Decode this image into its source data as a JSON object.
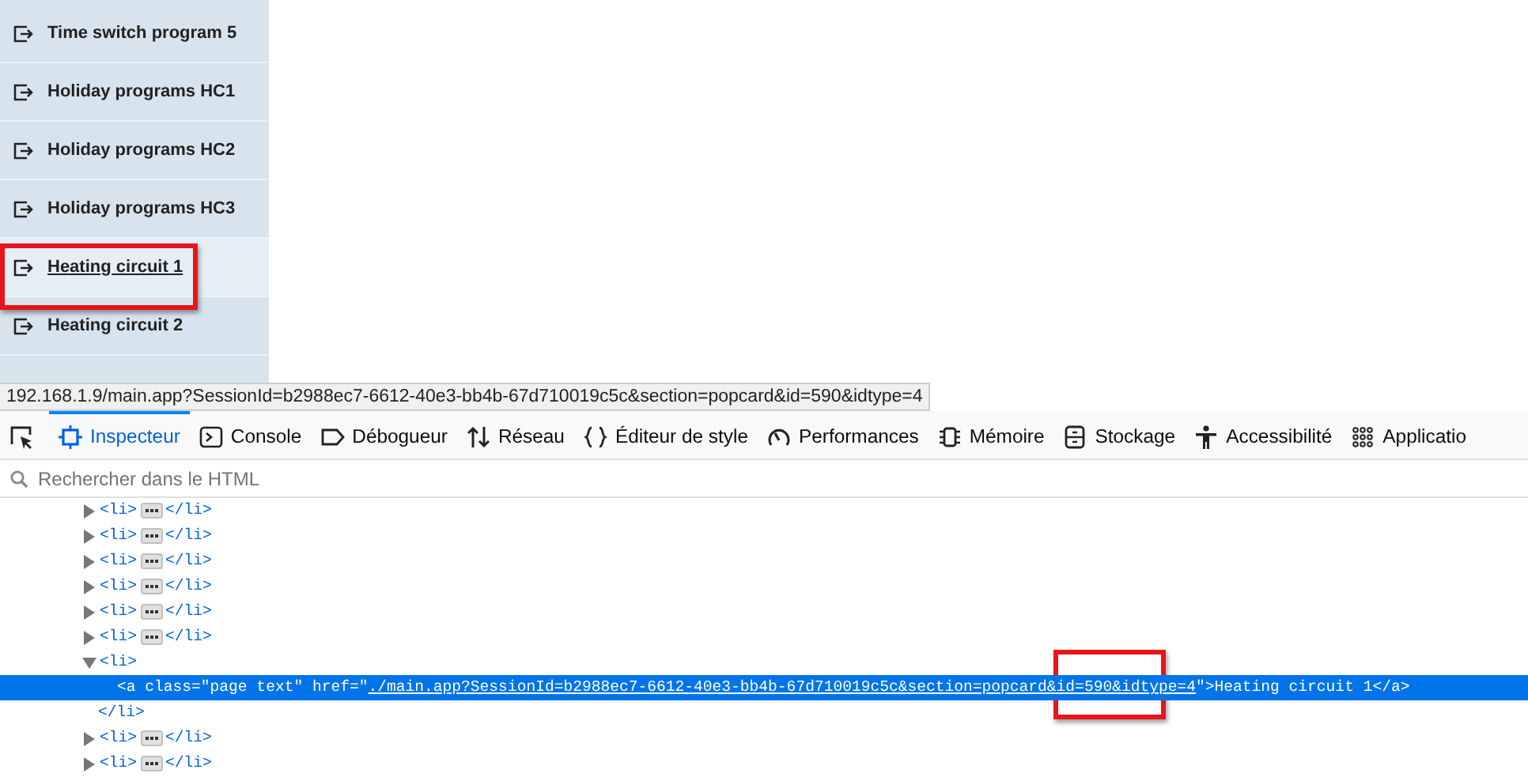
{
  "sidebar": {
    "items": [
      {
        "label": "Time switch program 5",
        "selected": false,
        "highlighted": false
      },
      {
        "label": "Holiday programs HC1",
        "selected": false,
        "highlighted": false
      },
      {
        "label": "Holiday programs HC2",
        "selected": false,
        "highlighted": false
      },
      {
        "label": "Holiday programs HC3",
        "selected": false,
        "highlighted": false
      },
      {
        "label": "Heating circuit 1",
        "selected": true,
        "highlighted": true
      },
      {
        "label": "Heating circuit 2",
        "selected": false,
        "highlighted": false
      }
    ]
  },
  "status_bar": {
    "url": "192.168.1.9/main.app?SessionId=b2988ec7-6612-40e3-bb4b-67d710019c5c&section=popcard&id=590&idtype=4"
  },
  "devtools": {
    "tabs": [
      {
        "kind": "picker",
        "selected": false
      },
      {
        "kind": "inspector",
        "label": "Inspecteur",
        "selected": true
      },
      {
        "kind": "console",
        "label": "Console",
        "selected": false
      },
      {
        "kind": "debugger",
        "label": "Débogueur",
        "selected": false
      },
      {
        "kind": "network",
        "label": "Réseau",
        "selected": false
      },
      {
        "kind": "style",
        "label": "Éditeur de style",
        "selected": false
      },
      {
        "kind": "performance",
        "label": "Performances",
        "selected": false
      },
      {
        "kind": "memory",
        "label": "Mémoire",
        "selected": false
      },
      {
        "kind": "storage",
        "label": "Stockage",
        "selected": false
      },
      {
        "kind": "accessibility",
        "label": "Accessibilité",
        "selected": false
      },
      {
        "kind": "application",
        "label": "Applicatio",
        "selected": false
      }
    ],
    "search": {
      "placeholder": "Rechercher dans le HTML"
    },
    "tree": [
      {
        "kind": "collapsed",
        "open": "<li>",
        "close": "</li>"
      },
      {
        "kind": "collapsed",
        "open": "<li>",
        "close": "</li>"
      },
      {
        "kind": "collapsed",
        "open": "<li>",
        "close": "</li>"
      },
      {
        "kind": "collapsed",
        "open": "<li>",
        "close": "</li>"
      },
      {
        "kind": "collapsed",
        "open": "<li>",
        "close": "</li>"
      },
      {
        "kind": "collapsed",
        "open": "<li>",
        "close": "</li>"
      },
      {
        "kind": "expanded",
        "open": "<li>"
      },
      {
        "kind": "link",
        "selected": true,
        "before": "<a class=\"page text\" href=\"",
        "link": "./main.app?SessionId=b2988ec7-6612-40e3-bb4b-67d710019c5c&section=popcard&id=590&idtype=4",
        "after": "\">Heating circuit 1</a>",
        "highlighted": true
      },
      {
        "kind": "closing",
        "close": "</li>"
      },
      {
        "kind": "collapsed",
        "open": "<li>",
        "close": "</li>"
      },
      {
        "kind": "collapsed",
        "open": "<li>",
        "close": "</li>"
      }
    ]
  }
}
